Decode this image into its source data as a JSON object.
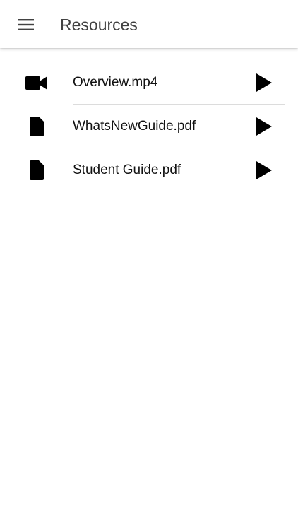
{
  "header": {
    "title": "Resources",
    "menu_icon": "hamburger-menu-icon"
  },
  "resources": [
    {
      "label": "Overview.mp4",
      "icon": "video-camera-icon",
      "action_icon": "play-icon"
    },
    {
      "label": "WhatsNewGuide.pdf",
      "icon": "document-icon",
      "action_icon": "play-icon"
    },
    {
      "label": "Student Guide.pdf",
      "icon": "document-icon",
      "action_icon": "play-icon"
    }
  ],
  "colors": {
    "background": "#ffffff",
    "title_text": "#424242",
    "item_text": "#111111",
    "divider": "#dcdcdc",
    "icon": "#000000"
  }
}
